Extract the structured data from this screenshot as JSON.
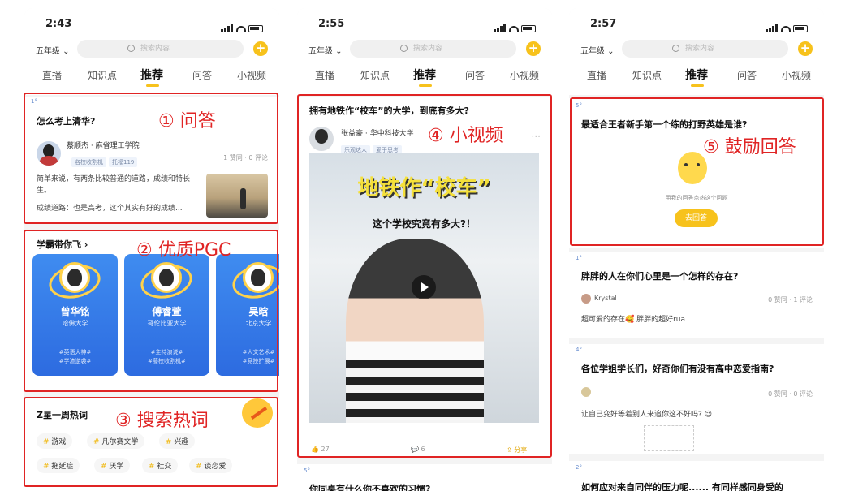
{
  "phone1": {
    "time": "2:43",
    "grade": "五年级",
    "search_placeholder": "搜索内容",
    "tabs": [
      "直播",
      "知识点",
      "推荐",
      "问答",
      "小视频"
    ],
    "qa": {
      "level": "1°",
      "title": "怎么考上清华?",
      "author": "蔡顺杰 · 麻省理工学院",
      "tags": [
        "名校收割机",
        "托福119"
      ],
      "stats": "1 赞同 · 0 评论",
      "body": "简单来说，有两条比较普通的道路，成绩和特长生。",
      "body2": "成绩道路：也是高考，这个其实有好的成绩..."
    },
    "pgc": {
      "title": "学霸带你飞",
      "items": [
        {
          "name": "曾华铭",
          "school": "哈佛大学",
          "hashtags": "#英语大神#\n#学渣逆袭#"
        },
        {
          "name": "傅睿萱",
          "school": "哥伦比亚大学",
          "hashtags": "#主持演说#\n#藤校收割机#"
        },
        {
          "name": "吴晗",
          "school": "北京大学",
          "hashtags": "#人文艺术#\n#竞技扩展#"
        }
      ]
    },
    "hotwords": {
      "title": "Z星一周热词",
      "row1": [
        "游戏",
        "凡尔赛文学",
        "兴趣"
      ],
      "row2": [
        "拖延症",
        "厌学",
        "社交",
        "谈恋爱"
      ]
    }
  },
  "phone2": {
    "time": "2:55",
    "grade": "五年级",
    "search_placeholder": "搜索内容",
    "tabs": [
      "直播",
      "知识点",
      "推荐",
      "问答",
      "小视频"
    ],
    "video": {
      "title": "拥有地铁作“校车”的大学，到底有多大?",
      "author": "张益豪 · 华中科技大学",
      "tags": [
        "乐观达人",
        "爱于思考"
      ],
      "headline": "地铁作“校车”",
      "subline": "这个学校究竟有多大?！",
      "likes": "27",
      "comments": "6",
      "share": "分享"
    },
    "next": {
      "level": "5°",
      "title": "你同桌有什么你不喜欢的习惯?"
    }
  },
  "phone3": {
    "time": "2:57",
    "grade": "五年级",
    "search_placeholder": "搜索内容",
    "tabs": [
      "直播",
      "知识点",
      "推荐",
      "问答",
      "小视频"
    ],
    "encourage": {
      "level": "5°",
      "title": "最适合王者新手第一个练的打野英雄是谁?",
      "hint": "用我的回答点热这个问题",
      "button": "去回答"
    },
    "q2": {
      "level": "1°",
      "title": "胖胖的人在你们心里是一个怎样的存在?",
      "user": "Krystal",
      "stats": "0 赞同 · 1 评论",
      "body": "超可爱的存在🥰 胖胖的超好rua"
    },
    "q3": {
      "level": "4°",
      "title": "各位学姐学长们，好奇你们有没有高中恋爱指南?",
      "stats": "0 赞同 · 0 评论",
      "body": "让自己变好等着别人来追你这不好吗? 😉"
    },
    "q4": {
      "level": "2°",
      "title": "如何应对来自同伴的压力呢...... 有同样感同身受的"
    }
  },
  "annotations": [
    "① 问答",
    "② 优质PGC",
    "③ 搜索热词",
    "④ 小视频",
    "⑤ 鼓励回答"
  ]
}
